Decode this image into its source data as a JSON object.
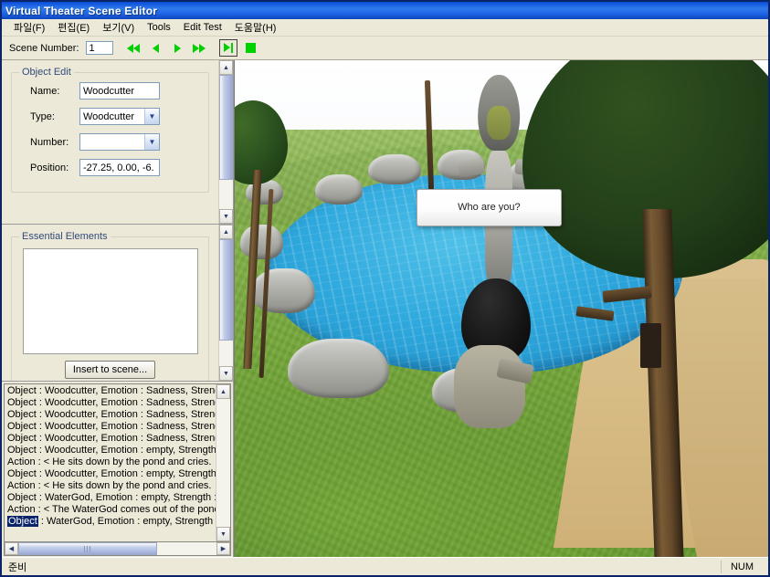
{
  "window": {
    "title": "Virtual Theater Scene Editor"
  },
  "menu": {
    "items": [
      {
        "label": "파일(F)",
        "name": "menu-file"
      },
      {
        "label": "편집(E)",
        "name": "menu-edit"
      },
      {
        "label": "보기(V)",
        "name": "menu-view"
      },
      {
        "label": "Tools",
        "name": "menu-tools"
      },
      {
        "label": "Edit Test",
        "name": "menu-edit-test"
      },
      {
        "label": "도움말(H)",
        "name": "menu-help"
      }
    ]
  },
  "toolbar": {
    "scene_number_label": "Scene Number:",
    "scene_number_value": "1",
    "buttons": [
      {
        "name": "first-scene-button",
        "icon": "rewind-icon"
      },
      {
        "name": "previous-scene-button",
        "icon": "previous-icon"
      },
      {
        "name": "next-scene-button",
        "icon": "next-icon"
      },
      {
        "name": "last-scene-button",
        "icon": "fast-forward-icon"
      },
      {
        "name": "play-button",
        "icon": "play-icon"
      },
      {
        "name": "stop-button",
        "icon": "stop-icon"
      }
    ]
  },
  "object_edit": {
    "group_title": "Object Edit",
    "name_label": "Name:",
    "name_value": "Woodcutter",
    "type_label": "Type:",
    "type_value": "Woodcutter",
    "number_label": "Number:",
    "number_value": "",
    "position_label": "Position:",
    "position_value": "-27.25, 0.00, -6."
  },
  "essential_elements": {
    "group_title": "Essential Elements",
    "list_items": [],
    "insert_button_label": "Insert to scene..."
  },
  "log": {
    "rows": [
      {
        "prefix": "Object",
        "text": " : Woodcutter, Emotion : Sadness, Strengt",
        "selected": false
      },
      {
        "prefix": "Object",
        "text": " : Woodcutter, Emotion : Sadness, Strengt",
        "selected": false
      },
      {
        "prefix": "Object",
        "text": " : Woodcutter, Emotion : Sadness, Strengt",
        "selected": false
      },
      {
        "prefix": "Object",
        "text": " : Woodcutter, Emotion : Sadness, Strengt",
        "selected": false
      },
      {
        "prefix": "Object",
        "text": " : Woodcutter, Emotion : Sadness, Strengt",
        "selected": false
      },
      {
        "prefix": "Object",
        "text": " : Woodcutter, Emotion : empty, Strength",
        "selected": false
      },
      {
        "prefix": "Action",
        "text": " : < He sits down by the pond and cries.",
        "selected": false
      },
      {
        "prefix": "Object",
        "text": " : Woodcutter, Emotion : empty, Strength",
        "selected": false
      },
      {
        "prefix": "Action",
        "text": " : < He sits down by the pond and cries.",
        "selected": false
      },
      {
        "prefix": "Object",
        "text": " : WaterGod, Emotion : empty, Strength :",
        "selected": false
      },
      {
        "prefix": "Action",
        "text": " : < The WaterGod comes out of the ponc",
        "selected": false
      },
      {
        "prefix": "Object",
        "text": " : WaterGod, Emotion : empty, Strength :",
        "selected": true
      }
    ]
  },
  "viewport": {
    "name": "scene-3d-viewport",
    "speech_bubble_text": "Who are you?",
    "scene_description": "Pond scene with rocks, trees, a grassy field, a sandy path and two characters"
  },
  "status_bar": {
    "left_text": "준비",
    "num_indicator": "NUM"
  },
  "colors": {
    "title_bar": "#1157dd",
    "window_face": "#ece9d8",
    "toolbar_green": "#00d200",
    "group_title": "#31497a",
    "selection": "#0a246a",
    "water": "#2ea8dd",
    "grass": "#74a63a",
    "path": "#d8bd86"
  }
}
